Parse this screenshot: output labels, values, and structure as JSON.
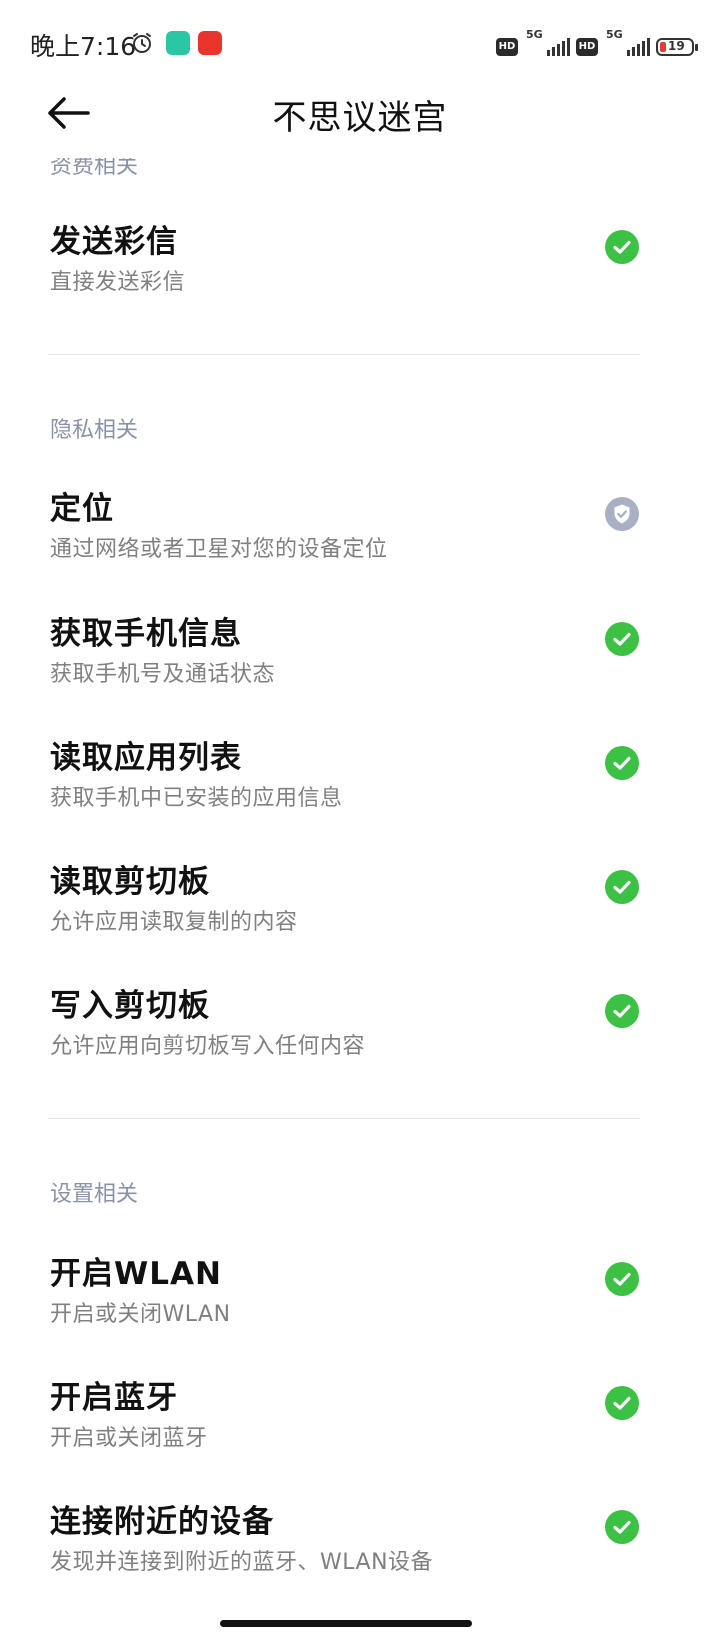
{
  "status_bar": {
    "time": "晚上7:16",
    "network_badge_1": "HD",
    "network_type_1": "5G",
    "network_badge_2": "HD",
    "network_type_2": "5G",
    "battery_level": "19"
  },
  "header": {
    "title": "不思议迷宫"
  },
  "sections": {
    "fees": {
      "label": "资费相关",
      "items": [
        {
          "title": "发送彩信",
          "desc": "直接发送彩信",
          "status": "allowed"
        }
      ]
    },
    "privacy": {
      "label": "隐私相关",
      "items": [
        {
          "title": "定位",
          "desc": "通过网络或者卫星对您的设备定位",
          "status": "ask"
        },
        {
          "title": "获取手机信息",
          "desc": "获取手机号及通话状态",
          "status": "allowed"
        },
        {
          "title": "读取应用列表",
          "desc": "获取手机中已安装的应用信息",
          "status": "allowed"
        },
        {
          "title": "读取剪切板",
          "desc": "允许应用读取复制的内容",
          "status": "allowed"
        },
        {
          "title": "写入剪切板",
          "desc": "允许应用向剪切板写入任何内容",
          "status": "allowed"
        }
      ]
    },
    "settings": {
      "label": "设置相关",
      "items": [
        {
          "title": "开启WLAN",
          "desc": "开启或关闭WLAN",
          "status": "allowed"
        },
        {
          "title": "开启蓝牙",
          "desc": "开启或关闭蓝牙",
          "status": "allowed"
        },
        {
          "title": "连接附近的设备",
          "desc": "发现并连接到附近的蓝牙、WLAN设备",
          "status": "allowed"
        }
      ]
    }
  },
  "colors": {
    "allowed": "#3cc145",
    "ask": "#a9b0c4",
    "section_label": "#8a93a6",
    "description": "#808080"
  }
}
